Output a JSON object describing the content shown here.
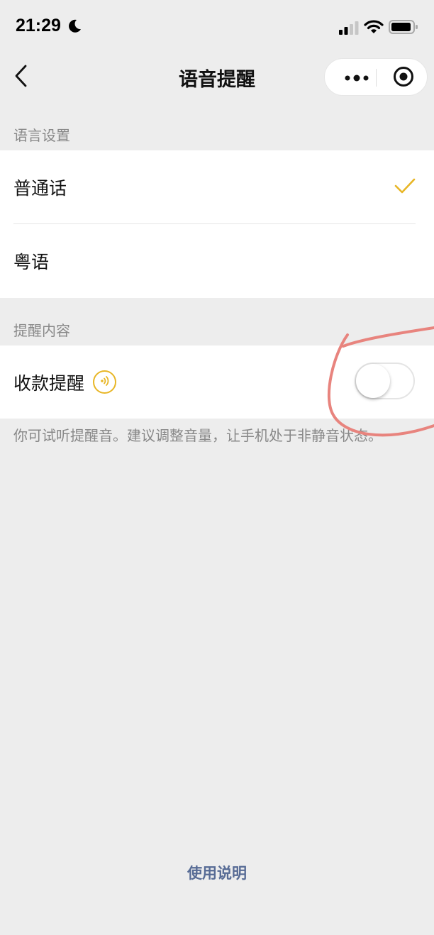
{
  "status_bar": {
    "time": "21:29"
  },
  "nav": {
    "title": "语音提醒"
  },
  "language_section": {
    "header": "语言设置",
    "options": [
      {
        "label": "普通话",
        "selected": true
      },
      {
        "label": "粤语",
        "selected": false
      }
    ]
  },
  "reminder_section": {
    "header": "提醒内容",
    "item_label": "收款提醒",
    "toggle_on": false
  },
  "hint_text": "你可试听提醒音。建议调整音量，让手机处于非静音状态。",
  "footer": {
    "link_label": "使用说明"
  },
  "colors": {
    "accent": "#e8b626",
    "link": "#576b95",
    "background": "#ededed",
    "annotation": "#e8847e"
  },
  "icons": [
    "moon-icon",
    "signal-icon",
    "wifi-icon",
    "battery-icon",
    "back-icon",
    "more-icon",
    "target-icon",
    "check-icon",
    "sound-icon"
  ]
}
